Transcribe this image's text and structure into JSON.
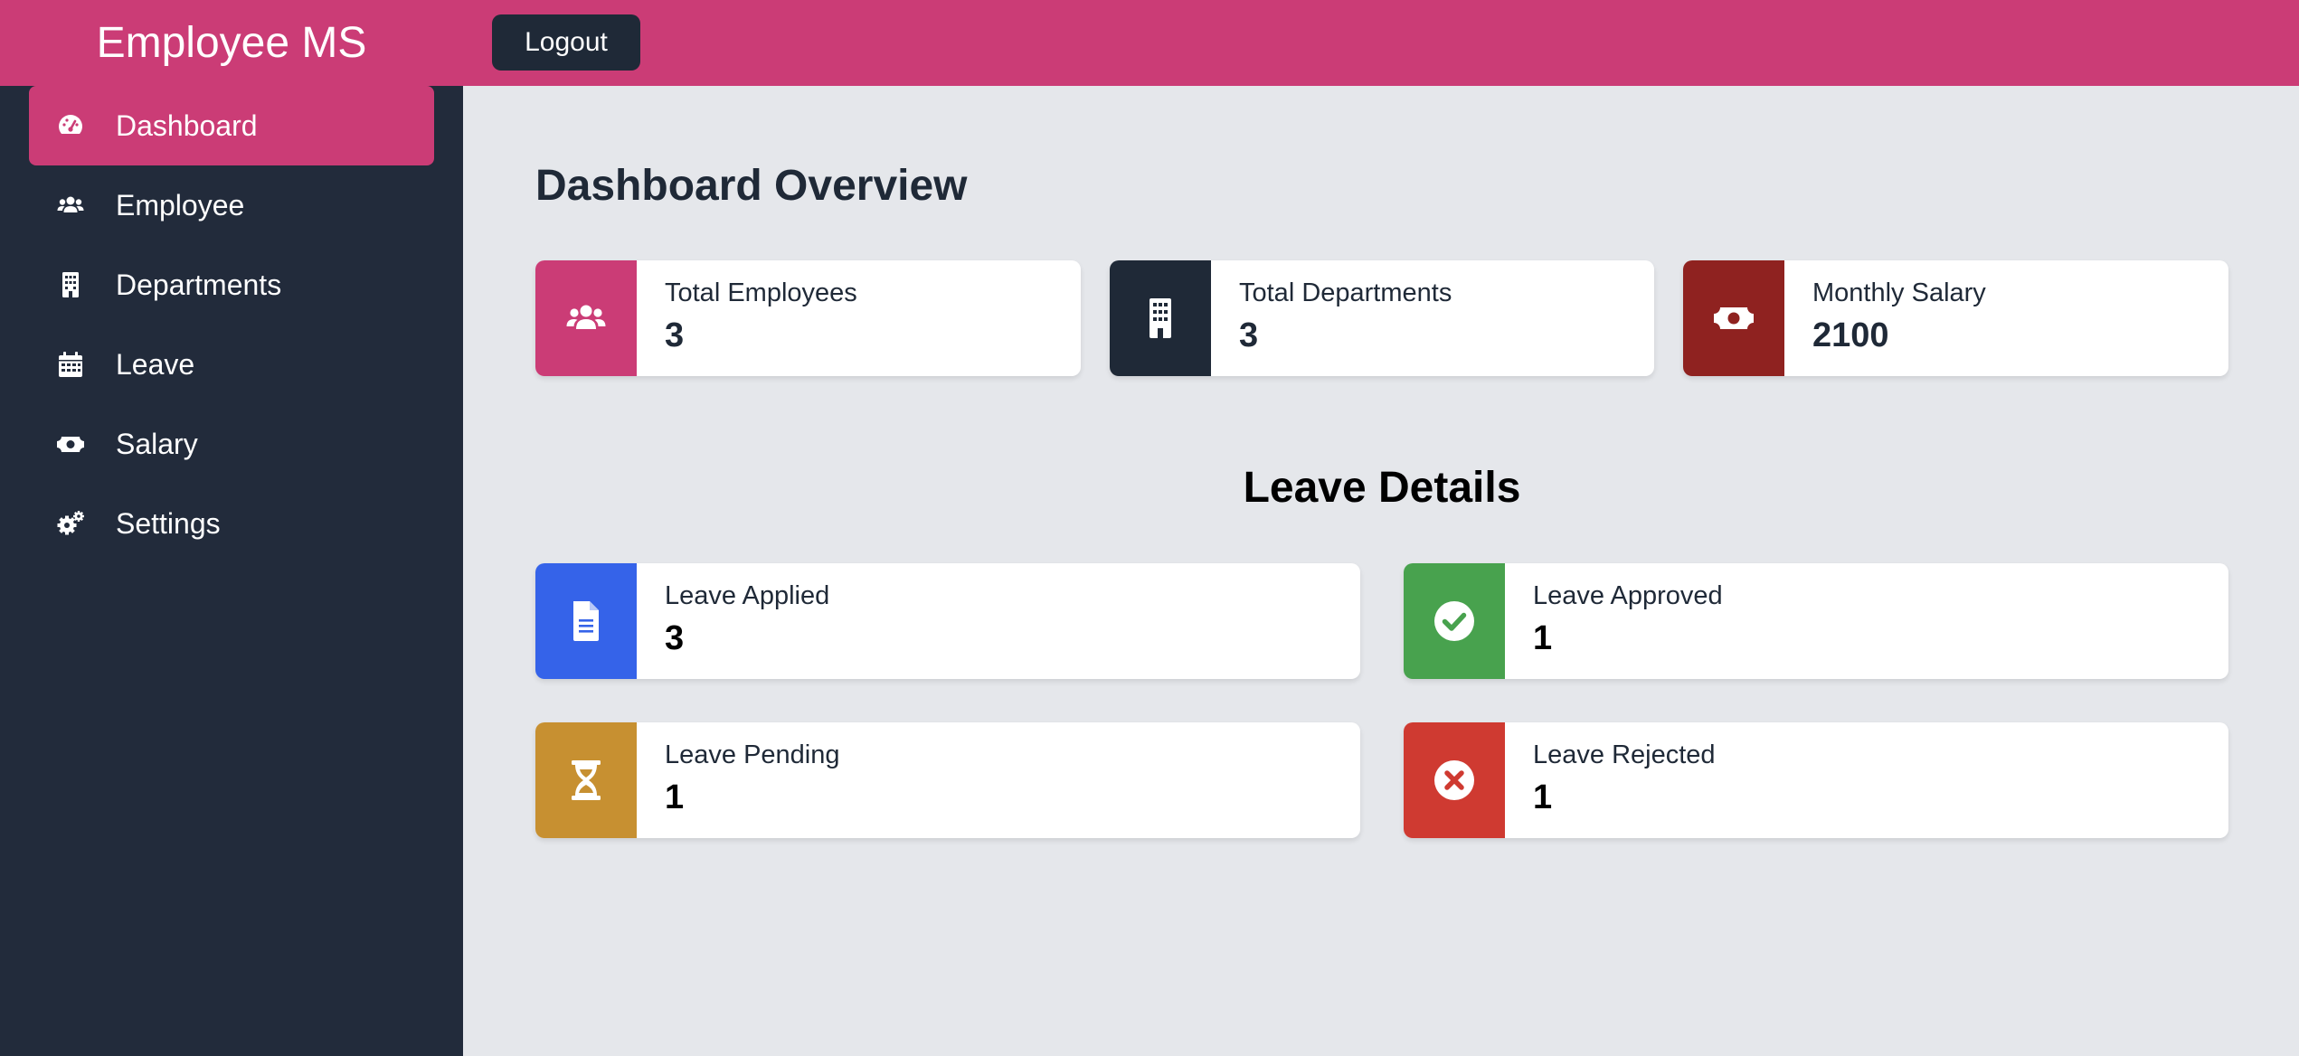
{
  "app": {
    "title": "Employee MS"
  },
  "header": {
    "logout_label": "Logout"
  },
  "sidebar": {
    "items": [
      {
        "label": "Dashboard",
        "icon": "dashboard-gauge-icon",
        "active": true
      },
      {
        "label": "Employee",
        "icon": "users-icon",
        "active": false
      },
      {
        "label": "Departments",
        "icon": "building-icon",
        "active": false
      },
      {
        "label": "Leave",
        "icon": "calendar-icon",
        "active": false
      },
      {
        "label": "Salary",
        "icon": "money-bill-icon",
        "active": false
      },
      {
        "label": "Settings",
        "icon": "cogs-icon",
        "active": false
      }
    ]
  },
  "overview": {
    "title": "Dashboard Overview",
    "cards": [
      {
        "label": "Total Employees",
        "value": "3",
        "icon": "users-icon",
        "color": "#cb3c76"
      },
      {
        "label": "Total Departments",
        "value": "3",
        "icon": "building-icon",
        "color": "#1f2937"
      },
      {
        "label": "Monthly Salary",
        "value": "2100",
        "icon": "money-bill-icon",
        "color": "#8f2220"
      }
    ]
  },
  "leave": {
    "title": "Leave Details",
    "cards": [
      {
        "label": "Leave Applied",
        "value": "3",
        "icon": "file-document-icon",
        "color": "#3563e9"
      },
      {
        "label": "Leave Approved",
        "value": "1",
        "icon": "check-circle-icon",
        "color": "#48a24e"
      },
      {
        "label": "Leave Pending",
        "value": "1",
        "icon": "hourglass-icon",
        "color": "#c79031"
      },
      {
        "label": "Leave Rejected",
        "value": "1",
        "icon": "times-circle-icon",
        "color": "#cf3a31"
      }
    ]
  },
  "colors": {
    "accent": "#cb3c76",
    "sidebar_bg": "#222b3b",
    "content_bg": "#e5e7eb",
    "logout_bg": "#1f2937"
  }
}
